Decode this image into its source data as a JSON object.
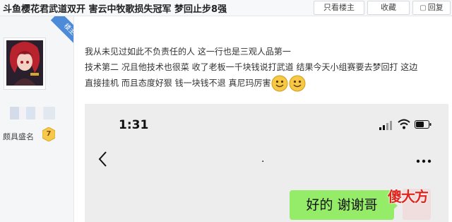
{
  "thread": {
    "title": "斗鱼樱花君武道双开 害云中牧歌损失冠军 梦回止步8强",
    "buttons": {
      "only_op": "只看楼主",
      "favorite": "收藏",
      "reply": "回复"
    }
  },
  "author": {
    "badge": "楼主",
    "rank": "颇具盛名",
    "level": "7"
  },
  "post": {
    "line1": "我从未见过如此不负责任的人 这一行也是三观人品第一",
    "line2": "技术第二 况且他技术也很菜 收了老板一千块钱说打武道 结果今天小组赛要去梦回打 这边",
    "line3": "直接挂机 而且态度好狠 钱一块钱不退 真尼玛厉害",
    "emojis": [
      "smile-emoji",
      "smile-emoji"
    ]
  },
  "screenshot": {
    "time": "1:31",
    "chat_title": ".",
    "message": "好的 谢谢哥"
  },
  "watermark": "傻大方",
  "colors": {
    "bubble": "#95ec69",
    "ribbon": "#4d8bd9",
    "watermark": "#e0261f"
  }
}
